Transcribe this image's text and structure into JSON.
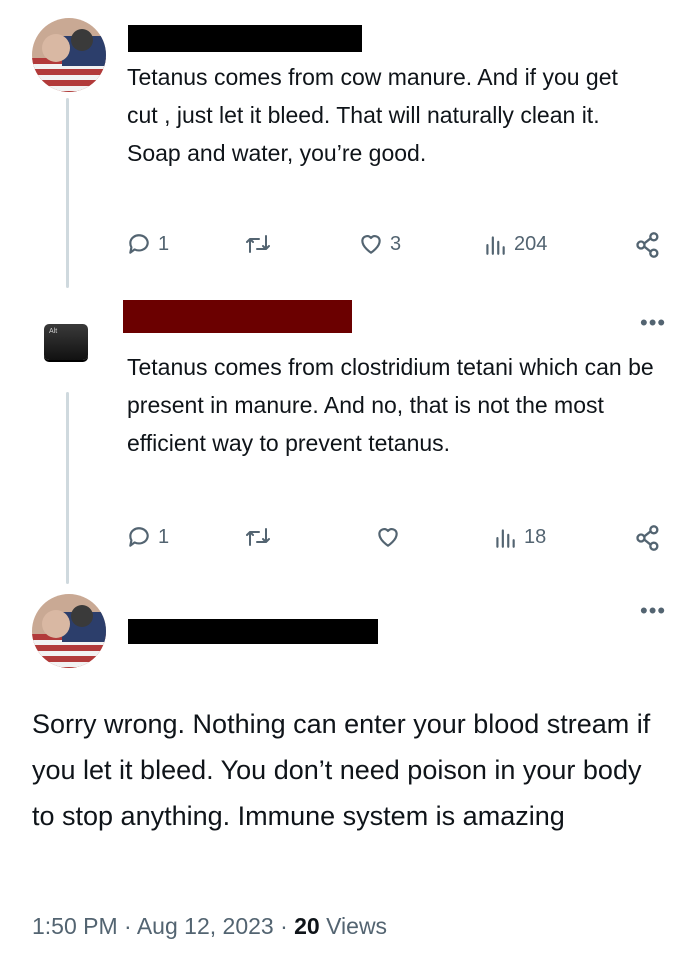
{
  "tweet1": {
    "text": "Tetanus comes from cow manure.  And if you get cut , just let it bleed.  That will naturally clean it.  Soap and water, you’re good.",
    "reply_count": "1",
    "like_count": "3",
    "view_count": "204"
  },
  "tweet2": {
    "avatar_key_label": "Alt",
    "text": "Tetanus comes from clostridium tetani which can be present in manure. And no, that is not the most efficient way to prevent tetanus.",
    "reply_count": "1",
    "view_count": "18"
  },
  "main_tweet": {
    "text": "Sorry wrong.  Nothing can enter your blood stream if you let it bleed.  You don’t need poison in your body to stop anything.  Immune system is amazing",
    "time": "1:50 PM",
    "sep1": "·",
    "date": "Aug 12, 2023",
    "sep2": "·",
    "views_count": "20",
    "views_label": "Views"
  },
  "colors": {
    "text": "#0f1419",
    "secondary": "#536471",
    "thread_line": "#cfd9de",
    "redact_black": "#000000",
    "redact_maroon": "#6b0000"
  },
  "icons": [
    "reply-icon",
    "retweet-icon",
    "like-icon",
    "views-icon",
    "share-icon",
    "more-icon"
  ]
}
